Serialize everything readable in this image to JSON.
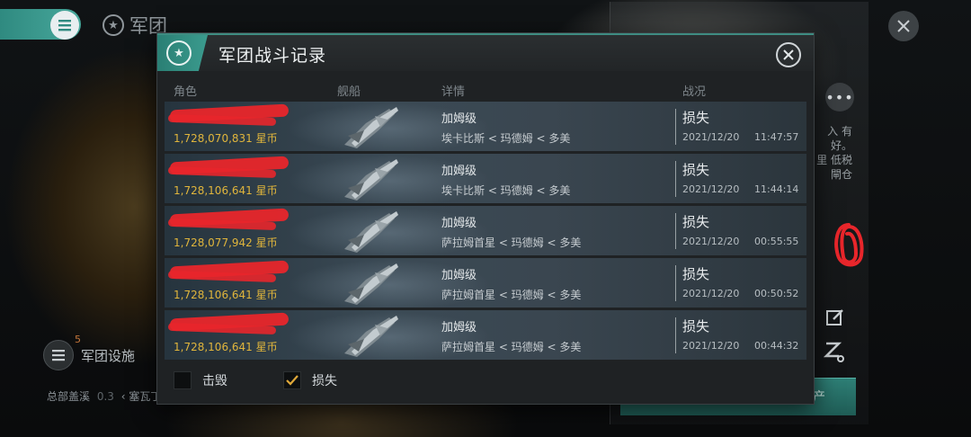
{
  "background": {
    "corp_title": "军团",
    "facility_label": "军团设施",
    "facility_badge": "5",
    "hq_label": "总部盖溪",
    "hq_value": "0.3",
    "hq_system": "塞瓦丁",
    "side_text": [
      "入 有",
      "好。",
      "里 低税",
      "閘仓"
    ],
    "bottom_button": "产"
  },
  "modal": {
    "title": "军团战斗记录",
    "columns": {
      "role": "角色",
      "ship": "舰船",
      "details": "详情",
      "status": "战况"
    },
    "rows": [
      {
        "isk": "1,728,070,831 星币",
        "ship": "加姆级",
        "location": "埃卡比斯 < 玛德姆 < 多美",
        "status": "损失",
        "date": "2021/12/20",
        "time": "11:47:57"
      },
      {
        "isk": "1,728,106,641 星币",
        "ship": "加姆级",
        "location": "埃卡比斯 < 玛德姆 < 多美",
        "status": "损失",
        "date": "2021/12/20",
        "time": "11:44:14"
      },
      {
        "isk": "1,728,077,942 星币",
        "ship": "加姆级",
        "location": "萨拉姆首星 < 玛德姆 < 多美",
        "status": "损失",
        "date": "2021/12/20",
        "time": "00:55:55"
      },
      {
        "isk": "1,728,106,641 星币",
        "ship": "加姆级",
        "location": "萨拉姆首星 < 玛德姆 < 多美",
        "status": "损失",
        "date": "2021/12/20",
        "time": "00:50:52"
      },
      {
        "isk": "1,728,106,641 星币",
        "ship": "加姆级",
        "location": "萨拉姆首星 < 玛德姆 < 多美",
        "status": "损失",
        "date": "2021/12/20",
        "time": "00:44:32"
      }
    ],
    "filters": [
      {
        "label": "击毁",
        "checked": false
      },
      {
        "label": "损失",
        "checked": true
      }
    ]
  },
  "colors": {
    "accent_teal": "#3b9b8e",
    "isk_gold": "#e0b53c",
    "redaction_red": "#e8262b"
  }
}
